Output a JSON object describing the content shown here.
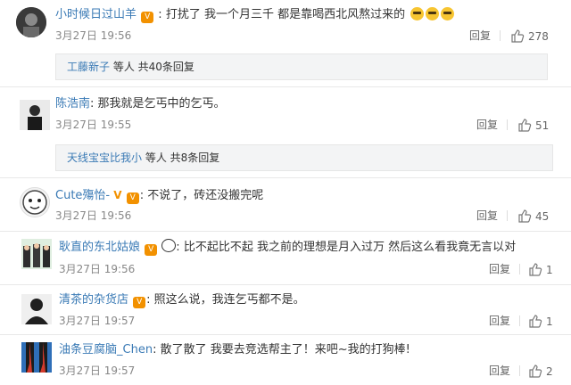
{
  "comments": [
    {
      "user": "小时候日过山羊",
      "text": "打扰了 我一个月三千 都是靠喝西北风熬过来的",
      "time": "3月27日 19:56",
      "reply": "回复",
      "likes": "278",
      "sub": {
        "user": "工藤新子",
        "rest": " 等人 共40条回复"
      }
    },
    {
      "user": "陈浩南",
      "text": "那我就是乞丐中的乞丐。",
      "time": "3月27日 19:55",
      "reply": "回复",
      "likes": "51",
      "sub": {
        "user": "天线宝宝比我小",
        "rest": " 等人 共8条回复"
      }
    },
    {
      "user": "Cute殤怡-",
      "text": "不说了，砖还没搬完呢",
      "time": "3月27日 19:56",
      "reply": "回复",
      "likes": "45"
    },
    {
      "user": "耿直的东北姑娘",
      "text": "比不起比不起 我之前的理想是月入过万 然后这么看我竟无言以对",
      "time": "3月27日 19:56",
      "reply": "回复",
      "likes": "1"
    },
    {
      "user": "清茶的杂货店",
      "text": "照这么说，我连乞丐都不是。",
      "time": "3月27日 19:57",
      "reply": "回复",
      "likes": "1"
    },
    {
      "user": "油条豆腐脑_Chen",
      "text": "散了散了 我要去竞选帮主了！来吧~我的打狗棒!",
      "time": "3月27日 19:57",
      "reply": "回复",
      "likes": "2"
    }
  ],
  "icons": {
    "like": "thumbs-up-icon",
    "vip": "vip-badge-icon",
    "emoji": "grin-emoji-icon",
    "v": "verified-v-icon",
    "panda": "panda-emoji-icon"
  }
}
